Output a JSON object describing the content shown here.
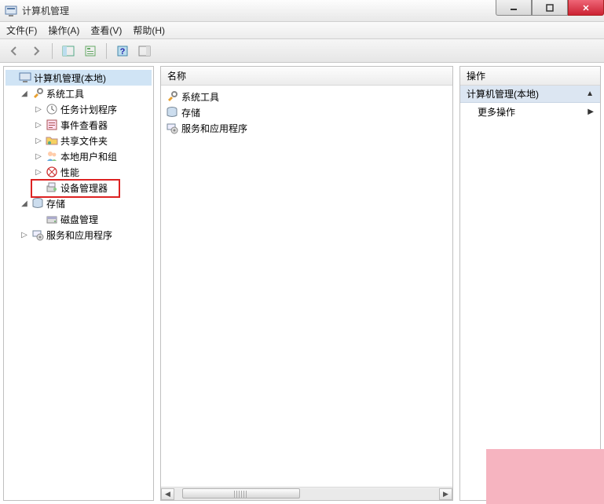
{
  "window": {
    "title": "计算机管理"
  },
  "menubar": {
    "file": "文件(F)",
    "action": "操作(A)",
    "view": "查看(V)",
    "help": "帮助(H)"
  },
  "tree": {
    "root": "计算机管理(本地)",
    "system_tools": "系统工具",
    "task_scheduler": "任务计划程序",
    "event_viewer": "事件查看器",
    "shared_folders": "共享文件夹",
    "local_users": "本地用户和组",
    "performance": "性能",
    "device_manager": "设备管理器",
    "storage": "存储",
    "disk_management": "磁盘管理",
    "services_apps": "服务和应用程序"
  },
  "center": {
    "header": "名称",
    "items": {
      "system_tools": "系统工具",
      "storage": "存储",
      "services_apps": "服务和应用程序"
    }
  },
  "actions": {
    "header": "操作",
    "section": "计算机管理(本地)",
    "more_actions": "更多操作"
  }
}
